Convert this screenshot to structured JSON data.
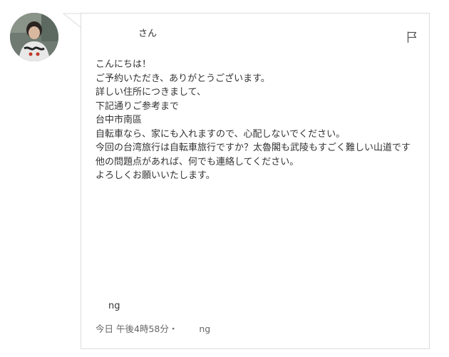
{
  "message": {
    "sender_suffix": "さん",
    "greeting": "こんにちは！",
    "thanks": "ご予約いただき、ありがとうございます。",
    "address_intro_1": "詳しい住所につきまして、",
    "address_intro_2": "下記通りご参考まで",
    "address": "台中市南區",
    "bicycle_note": "自転車なら、家にも入れますので、心配しないでください。",
    "trip_question": "今回の台湾旅行は自転車旅行ですか？太魯閣も武陵もすごく難しい山道です",
    "contact_note_1": "他の問題点があれば、何でも連絡してください。",
    "contact_note_2": "よろしくお願いいたします。",
    "signature_suffix": "ng"
  },
  "meta": {
    "date": "今日",
    "time": "午後4時58分",
    "separator": "・",
    "author_suffix": "ng"
  },
  "icons": {
    "avatar": "profile-photo",
    "flag": "flag-icon"
  },
  "colors": {
    "border": "#dcdcdc",
    "text": "#333333",
    "meta_text": "#666666"
  }
}
